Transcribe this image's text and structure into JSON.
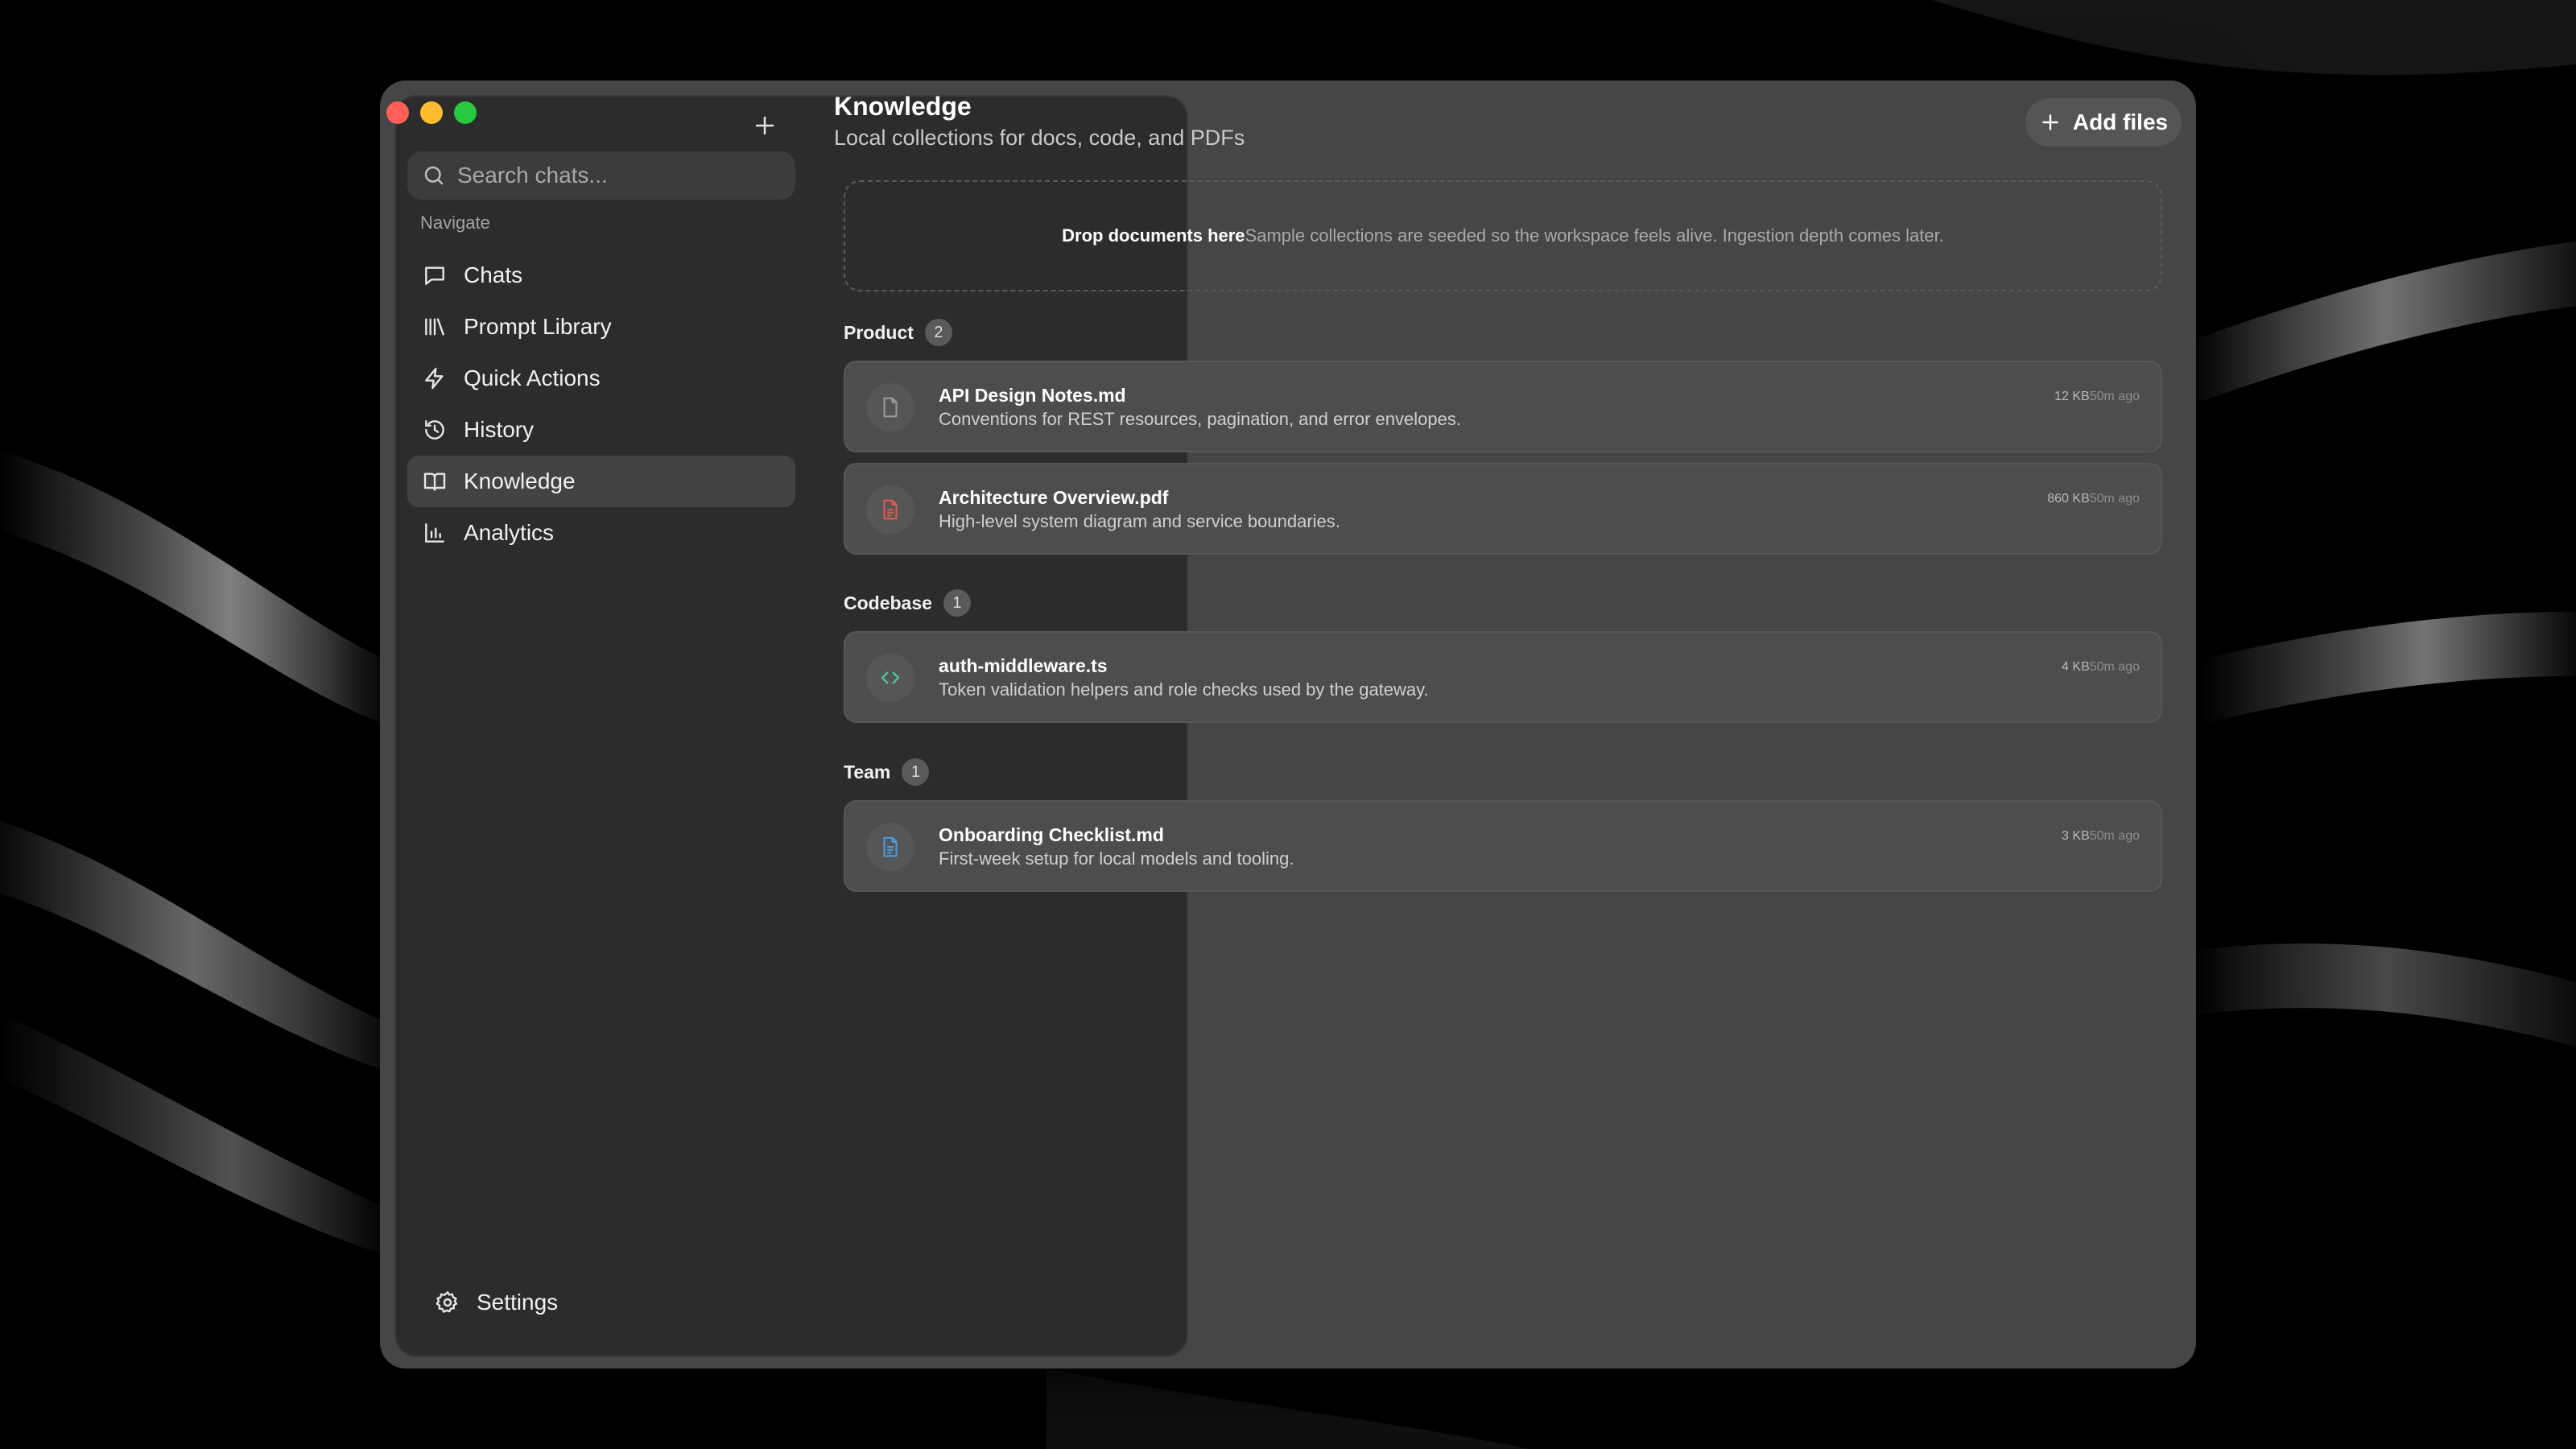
{
  "window": {
    "traffic_lights": [
      "close",
      "minimize",
      "zoom"
    ]
  },
  "sidebar": {
    "new_chat_icon": "plus-icon",
    "search": {
      "placeholder": "Search chats...",
      "value": ""
    },
    "nav_heading": "Navigate",
    "items": [
      {
        "label": "Chats",
        "icon": "message-square-icon",
        "active": false
      },
      {
        "label": "Prompt Library",
        "icon": "library-icon",
        "active": false
      },
      {
        "label": "Quick Actions",
        "icon": "zap-icon",
        "active": false
      },
      {
        "label": "History",
        "icon": "history-icon",
        "active": false
      },
      {
        "label": "Knowledge",
        "icon": "book-open-icon",
        "active": true
      },
      {
        "label": "Analytics",
        "icon": "bar-chart-icon",
        "active": false
      }
    ],
    "settings_label": "Settings"
  },
  "main": {
    "title": "Knowledge",
    "subtitle": "Local collections for docs, code, and PDFs",
    "add_files_label": "Add files",
    "dropzone": {
      "title": "Drop documents here",
      "description": "Sample collections are seeded so the workspace feels alive. Ingestion depth comes later."
    },
    "groups": [
      {
        "name": "Product",
        "count": "2",
        "files": [
          {
            "name": "API Design Notes.md",
            "description": "Conventions for REST resources, pagination, and error envelopes.",
            "size": "12 KB",
            "ago": "50m ago",
            "icon": "file-icon",
            "color": "#9a9a9a"
          },
          {
            "name": "Architecture Overview.pdf",
            "description": "High-level system diagram and service boundaries.",
            "size": "860 KB",
            "ago": "50m ago",
            "icon": "file-text-icon",
            "color": "#e05a4f"
          }
        ]
      },
      {
        "name": "Codebase",
        "count": "1",
        "files": [
          {
            "name": "auth-middleware.ts",
            "description": "Token validation helpers and role checks used by the gateway.",
            "size": "4 KB",
            "ago": "50m ago",
            "icon": "code-icon",
            "color": "#4fc29a"
          }
        ]
      },
      {
        "name": "Team",
        "count": "1",
        "files": [
          {
            "name": "Onboarding Checklist.md",
            "description": "First-week setup for local models and tooling.",
            "size": "3 KB",
            "ago": "50m ago",
            "icon": "file-text-icon",
            "color": "#4a9be0"
          }
        ]
      }
    ]
  },
  "colors": {
    "window_bg": "#464646",
    "sidebar_bg": "#2c2c2c",
    "active_item_bg": "#434343",
    "card_bg": "#4d4d4d"
  }
}
